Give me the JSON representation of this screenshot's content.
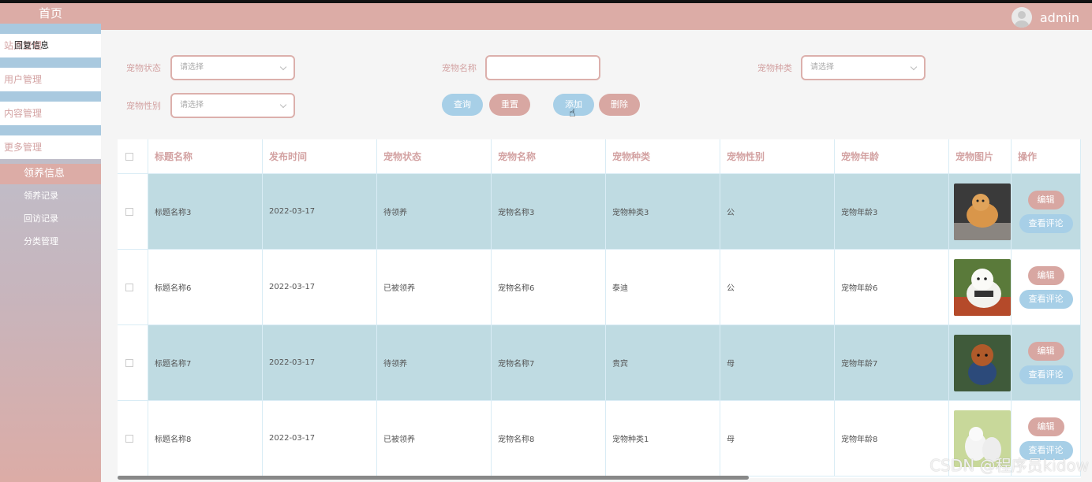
{
  "header": {
    "username": "admin"
  },
  "sidebar": {
    "home": "首页",
    "overlay_text": "回复信息",
    "items": [
      {
        "label": "站点管理"
      },
      {
        "label": "用户管理"
      },
      {
        "label": "内容管理"
      },
      {
        "label": "更多管理"
      }
    ],
    "active": "领养信息",
    "subs": [
      {
        "label": "领养记录"
      },
      {
        "label": "回访记录"
      },
      {
        "label": "分类管理"
      }
    ]
  },
  "filters": {
    "status_label": "宠物状态",
    "status_placeholder": "请选择",
    "name_label": "宠物名称",
    "name_value": "",
    "type_label": "宠物种类",
    "type_placeholder": "请选择",
    "gender_label": "宠物性别",
    "gender_placeholder": "请选择",
    "query_btn": "查询",
    "reset_btn": "重置",
    "add_btn": "添加",
    "delete_btn": "删除"
  },
  "table": {
    "columns": [
      "标题名称",
      "发布时间",
      "宠物状态",
      "宠物名称",
      "宠物种类",
      "宠物性别",
      "宠物年龄",
      "宠物图片",
      "操作"
    ],
    "edit_label": "编辑",
    "comment_label": "查看评论",
    "rows": [
      {
        "title": "标题名称3",
        "date": "2022-03-17",
        "status": "待领养",
        "name": "宠物名称3",
        "type": "宠物种类3",
        "gender": "公",
        "age": "宠物年龄3",
        "photo": "pomeranian-dog-photo"
      },
      {
        "title": "标题名称6",
        "date": "2022-03-17",
        "status": "已被领养",
        "name": "宠物名称6",
        "type": "泰迪",
        "gender": "公",
        "age": "宠物年龄6",
        "photo": "white-poodle-photo"
      },
      {
        "title": "标题名称7",
        "date": "2022-03-17",
        "status": "待领养",
        "name": "宠物名称7",
        "type": "贵宾",
        "gender": "母",
        "age": "宠物年龄7",
        "photo": "brown-poodle-photo"
      },
      {
        "title": "标题名称8",
        "date": "2022-03-17",
        "status": "已被领养",
        "name": "宠物名称8",
        "type": "宠物种类1",
        "gender": "母",
        "age": "宠物年龄8",
        "photo": "white-dogs-photo"
      }
    ]
  },
  "watermark": "CSDN @程序员kidow",
  "colors": {
    "primary_pink": "#dcaca6",
    "primary_blue": "#a7cfe7",
    "row_blue": "#bfdbe2"
  }
}
